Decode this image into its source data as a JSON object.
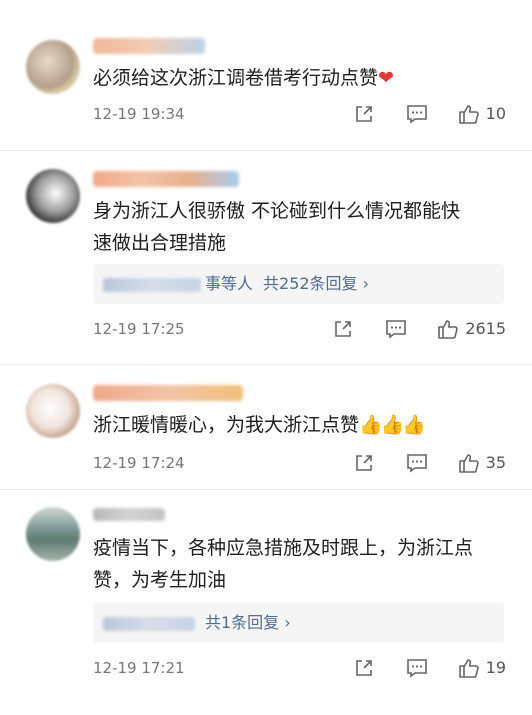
{
  "comments": [
    {
      "text": "必须给这次浙江调卷借考行动点赞",
      "emoji": "❤",
      "time": "12-19 19:34",
      "likes": "10"
    },
    {
      "text_line1": "身为浙江人很骄傲  不论碰到什么情况都能快",
      "text_line2": "速做出合理措施",
      "reply_who": "事等人",
      "reply_more": "共252条回复 ›",
      "time": "12-19 17:25",
      "likes": "2615"
    },
    {
      "text": "浙江暖情暖心，为我大浙江点赞",
      "emoji": "👍👍👍",
      "time": "12-19 17:24",
      "likes": "35"
    },
    {
      "text_line1": "疫情当下，各种应急措施及时跟上，为浙江点",
      "text_line2": "赞，为考生加油",
      "reply_more": "共1条回复 ›",
      "time": "12-19 17:21",
      "likes": "19"
    }
  ],
  "icons": [
    "share-icon",
    "comment-icon",
    "like-icon"
  ],
  "colors": {
    "link": "#506c94",
    "reply_bg": "#f5f5f5",
    "heart": "#e03a3a"
  }
}
